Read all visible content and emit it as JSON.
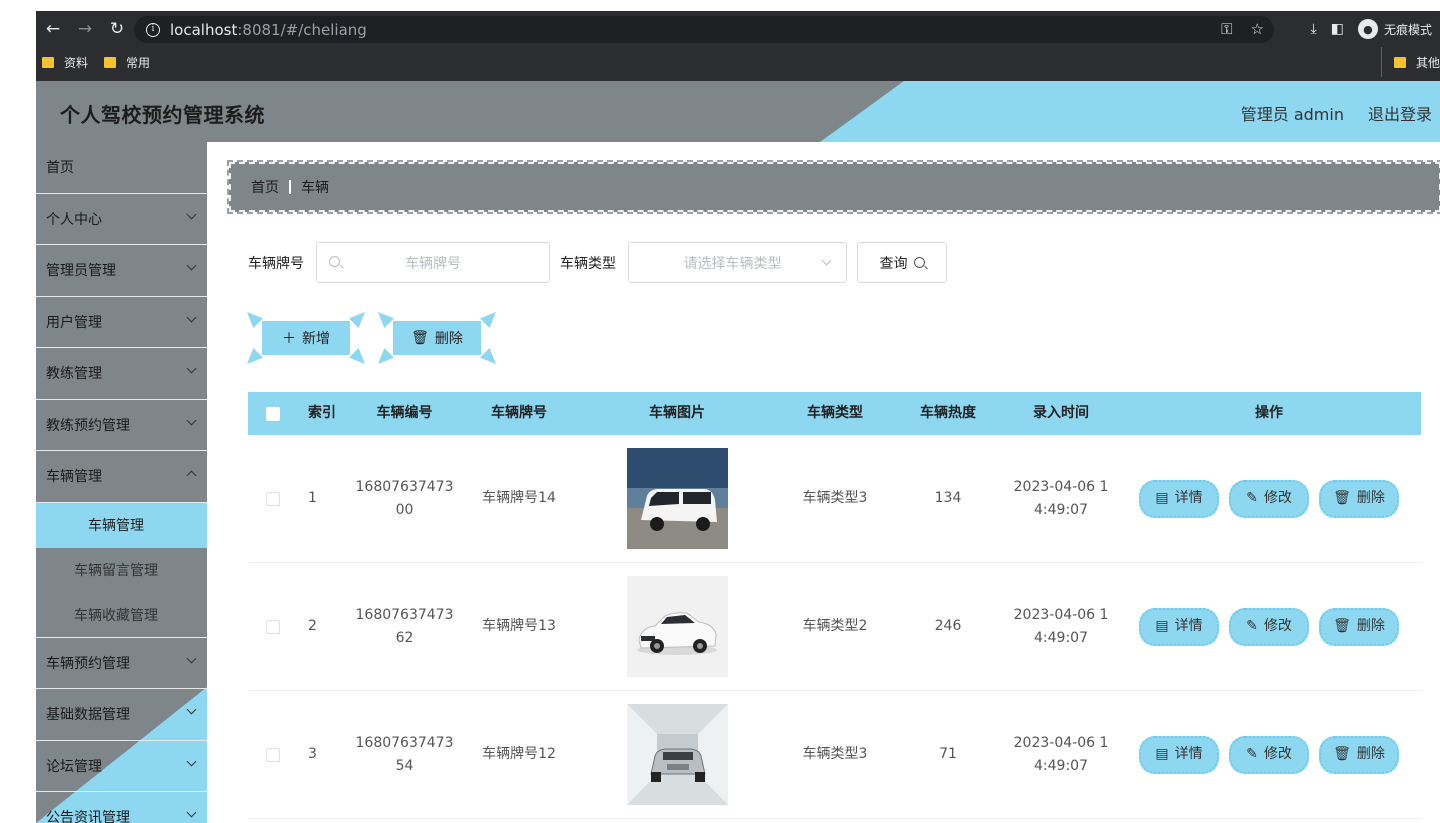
{
  "browser": {
    "url_host": "localhost",
    "url_rest": ":8081/#/cheliang",
    "incognito_label": "无痕模式",
    "bookmarks": [
      "资料",
      "常用"
    ],
    "other_bookmarks": "其他"
  },
  "header": {
    "title": "个人驾校预约管理系统",
    "user": "管理员 admin",
    "logout": "退出登录"
  },
  "sidebar": {
    "items": [
      {
        "label": "首页",
        "chevron": false
      },
      {
        "label": "个人中心",
        "chevron": true
      },
      {
        "label": "管理员管理",
        "chevron": true
      },
      {
        "label": "用户管理",
        "chevron": true
      },
      {
        "label": "教练管理",
        "chevron": true
      },
      {
        "label": "教练预约管理",
        "chevron": true
      },
      {
        "label": "车辆管理",
        "chevron": true
      }
    ],
    "sub_items": [
      "车辆管理",
      "车辆留言管理",
      "车辆收藏管理"
    ],
    "items_after": [
      "车辆预约管理",
      "基础数据管理",
      "论坛管理",
      "公告资讯管理"
    ]
  },
  "breadcrumb": {
    "home": "首页",
    "current": "车辆"
  },
  "filters": {
    "plate_label": "车辆牌号",
    "plate_placeholder": "车辆牌号",
    "type_label": "车辆类型",
    "type_placeholder": "请选择车辆类型",
    "query_button": "查询"
  },
  "actions": {
    "add": "新增",
    "delete": "删除"
  },
  "table": {
    "headers": [
      "索引",
      "车辆编号",
      "车辆牌号",
      "车辆图片",
      "车辆类型",
      "车辆热度",
      "录入时间",
      "操作"
    ],
    "rows": [
      {
        "index": "1",
        "no_line1": "16807637473",
        "no_line2": "00",
        "plate": "车辆牌号14",
        "type": "车辆类型3",
        "heat": "134",
        "time_line1": "2023-04-06 1",
        "time_line2": "4:49:07",
        "img": "van"
      },
      {
        "index": "2",
        "no_line1": "16807637473",
        "no_line2": "62",
        "plate": "车辆牌号13",
        "type": "车辆类型2",
        "heat": "246",
        "time_line1": "2023-04-06 1",
        "time_line2": "4:49:07",
        "img": "coupe"
      },
      {
        "index": "3",
        "no_line1": "16807637473",
        "no_line2": "54",
        "plate": "车辆牌号12",
        "type": "车辆类型3",
        "heat": "71",
        "time_line1": "2023-04-06 1",
        "time_line2": "4:49:07",
        "img": "suv"
      }
    ],
    "ops": {
      "detail": "详情",
      "edit": "修改",
      "delete": "删除"
    }
  },
  "colors": {
    "accent": "#8dd7f1",
    "panel": "#7f868a"
  }
}
